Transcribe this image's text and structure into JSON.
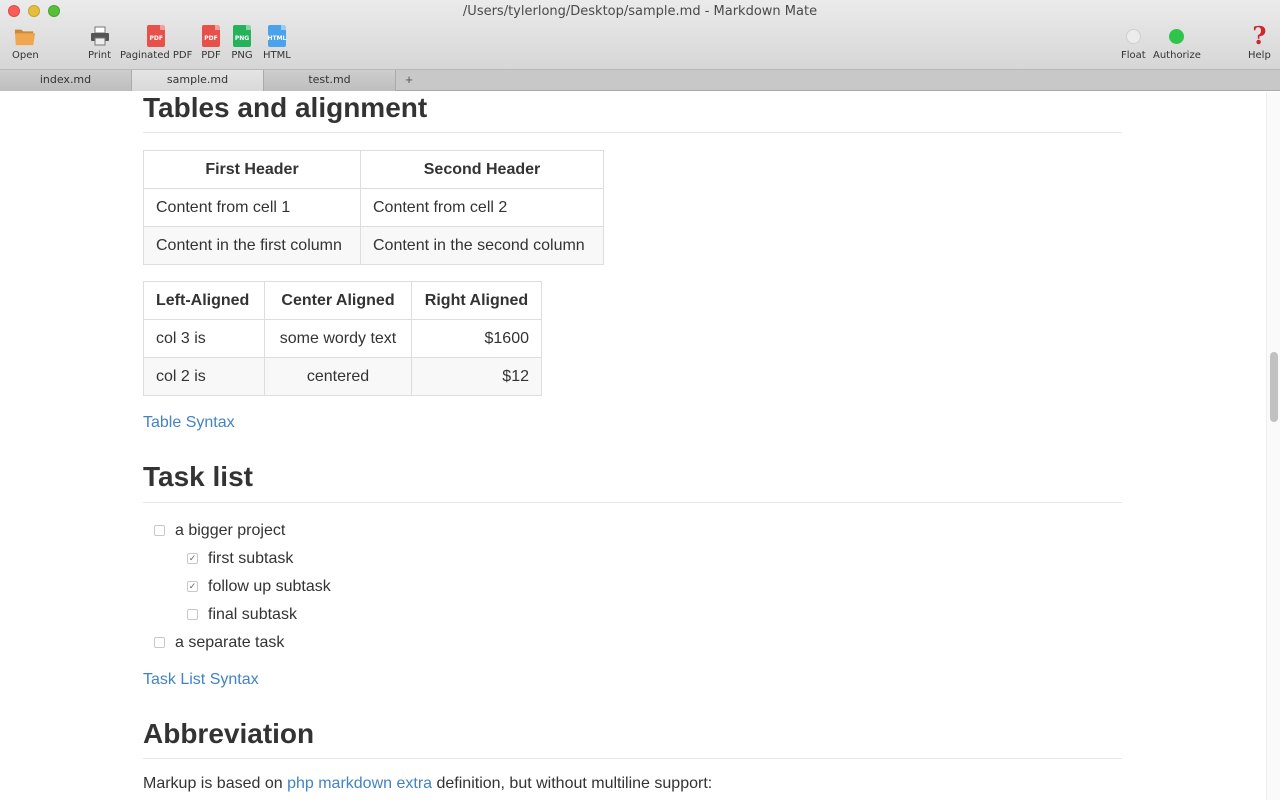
{
  "window": {
    "title": "/Users/tylerlong/Desktop/sample.md - Markdown Mate"
  },
  "toolbar": {
    "open": "Open",
    "print": "Print",
    "paginated_pdf": "Paginated PDF",
    "pdf": "PDF",
    "png": "PNG",
    "html": "HTML",
    "float": "Float",
    "authorize": "Authorize",
    "help": "Help",
    "pdf_glyph": "PDF",
    "png_glyph": "PNG",
    "html_glyph": "HTML",
    "help_glyph": "?"
  },
  "tabs": [
    {
      "label": "index.md"
    },
    {
      "label": "sample.md",
      "active": true
    },
    {
      "label": "test.md"
    }
  ],
  "tab_add": "+",
  "doc": {
    "tables_heading": "Tables and alignment",
    "table1": {
      "headers": [
        "First Header",
        "Second Header"
      ],
      "rows": [
        [
          "Content from cell 1",
          "Content from cell 2"
        ],
        [
          "Content in the first column",
          "Content in the second column"
        ]
      ]
    },
    "table2": {
      "headers": [
        "Left-Aligned",
        "Center Aligned",
        "Right Aligned"
      ],
      "rows": [
        [
          "col 3 is",
          "some wordy text",
          "$1600"
        ],
        [
          "col 2 is",
          "centered",
          "$12"
        ]
      ]
    },
    "table_syntax_link": "Table Syntax",
    "task_heading": "Task list",
    "tasks": [
      {
        "label": "a bigger project",
        "checked": false
      },
      {
        "label": "first subtask",
        "checked": true
      },
      {
        "label": "follow up subtask",
        "checked": true
      },
      {
        "label": "final subtask",
        "checked": false
      },
      {
        "label": "a separate task",
        "checked": false
      }
    ],
    "check_glyph": "✓",
    "task_syntax_link": "Task List Syntax",
    "abbr_heading": "Abbreviation",
    "abbr_para_prefix": "Markup is based on ",
    "abbr_para_link": "php markdown extra",
    "abbr_para_suffix": " definition, but without multiline support:"
  }
}
